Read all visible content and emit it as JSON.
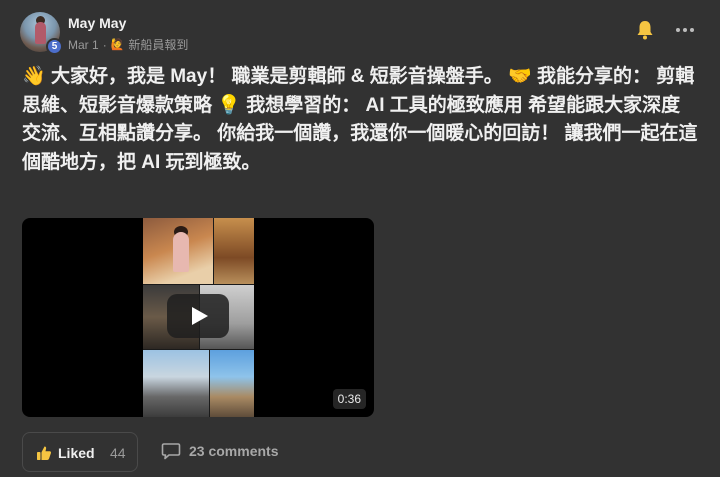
{
  "post": {
    "author": {
      "name": "May May",
      "level": "5"
    },
    "date": "Mar 1",
    "separator": "·",
    "category": {
      "emoji": "🙋",
      "label": "新船員報到"
    },
    "body": {
      "emoji_wave": "👋",
      "intro": "大家好，我是 May！ 職業是剪輯師 & 短影音操盤手。 ",
      "emoji_handshake": "🤝",
      "share": " 我能分享的： 剪輯思維、短影音爆款策略 ",
      "emoji_bulb": "💡",
      "learn": " 我想學習的： AI 工具的極致應用 希望能跟大家深度交流、互相點讚分享。 你給我一個讚，我還你一個暖心的回訪！ 讓我們一起在這個酷地方，把 AI 玩到極致。"
    },
    "video": {
      "duration": "0:36"
    },
    "actions": {
      "like_label": "Liked",
      "like_count": "44",
      "comments_label": "23 comments"
    }
  },
  "icons": {
    "bell": "bell-icon",
    "more": "more-options-icon",
    "like": "thumbs-up-icon",
    "comment": "comment-icon",
    "play": "play-icon"
  },
  "colors": {
    "background": "#323232",
    "text": "#f0f0f0",
    "muted": "#9a9a9a",
    "bell": "#f5c542",
    "level_badge": "#4c6ecb"
  }
}
